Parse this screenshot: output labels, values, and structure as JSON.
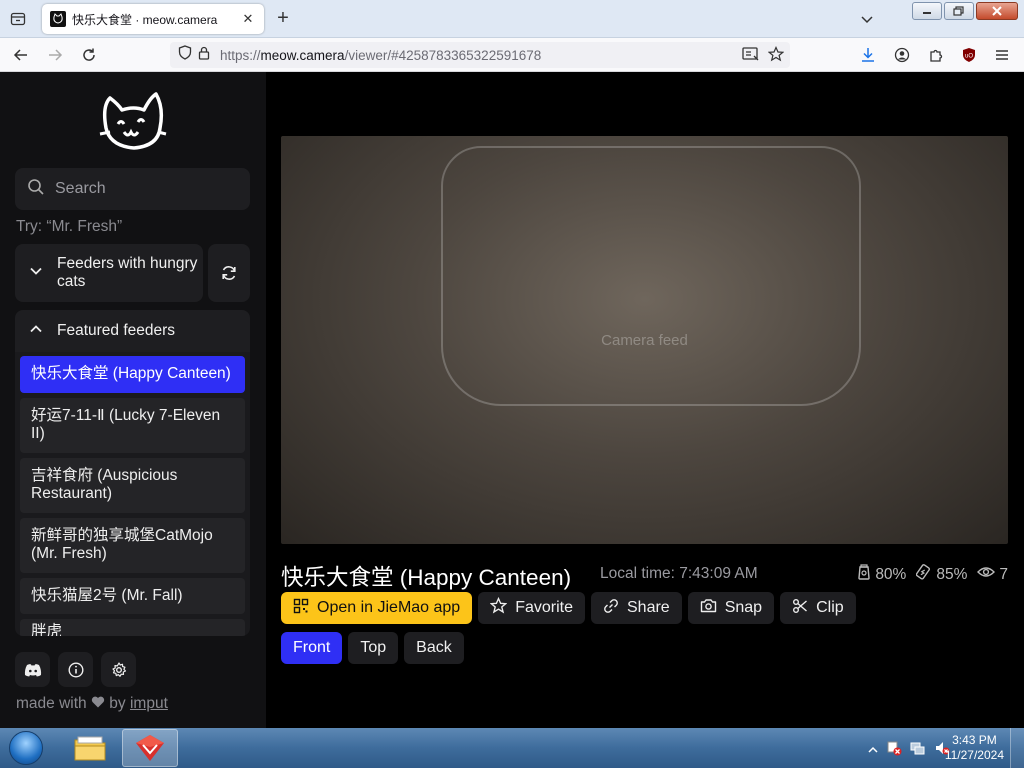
{
  "browser": {
    "tab_title": "快乐大食堂 · meow.camera",
    "tab_close": "✕",
    "new_tab": "+",
    "url_scheme": "https://",
    "url_host": "meow.camera",
    "url_path": "/viewer/#4258783365322591678",
    "icons": [
      "tab-list-icon",
      "back-icon",
      "forward-icon",
      "reload-icon",
      "shield-icon",
      "lock-icon",
      "reader-icon",
      "bookmark-star-icon",
      "download-icon",
      "account-icon",
      "extensions-icon",
      "ublock-icon",
      "menu-icon"
    ]
  },
  "sidebar": {
    "search_placeholder": "Search",
    "try_text": "Try: “Mr. Fresh”",
    "hungry_label": "Feeders with hungry cats",
    "featured_label": "Featured feeders",
    "feeders": [
      "快乐大食堂 (Happy Canteen)",
      "好运7-11-Ⅱ (Lucky 7-Eleven II)",
      "吉祥食府 (Auspicious Restaurant)",
      "新鲜哥的独享城堡CatMojo (Mr. Fresh)",
      "快乐猫屋2号 (Mr. Fall)",
      "胖虎"
    ],
    "made_with": "made with",
    "made_by": "by",
    "author": "imput"
  },
  "viewer": {
    "video_label": "Camera feed",
    "feeder_title": "快乐大食堂 (Happy Canteen)",
    "local_time": "Local time: 7:43:09 AM",
    "stats": {
      "food": "80%",
      "battery": "85%",
      "viewers": "7"
    },
    "actions": {
      "open_app": "Open in JieMao app",
      "favorite": "Favorite",
      "share": "Share",
      "snap": "Snap",
      "clip": "Clip"
    },
    "views": {
      "front": "Front",
      "top": "Top",
      "back": "Back"
    }
  },
  "taskbar": {
    "time": "3:43 PM",
    "date": "11/27/2024"
  },
  "colors": {
    "accent": "#2f2ff5",
    "primary_button": "#fcc419",
    "sidebar": "#111113"
  }
}
